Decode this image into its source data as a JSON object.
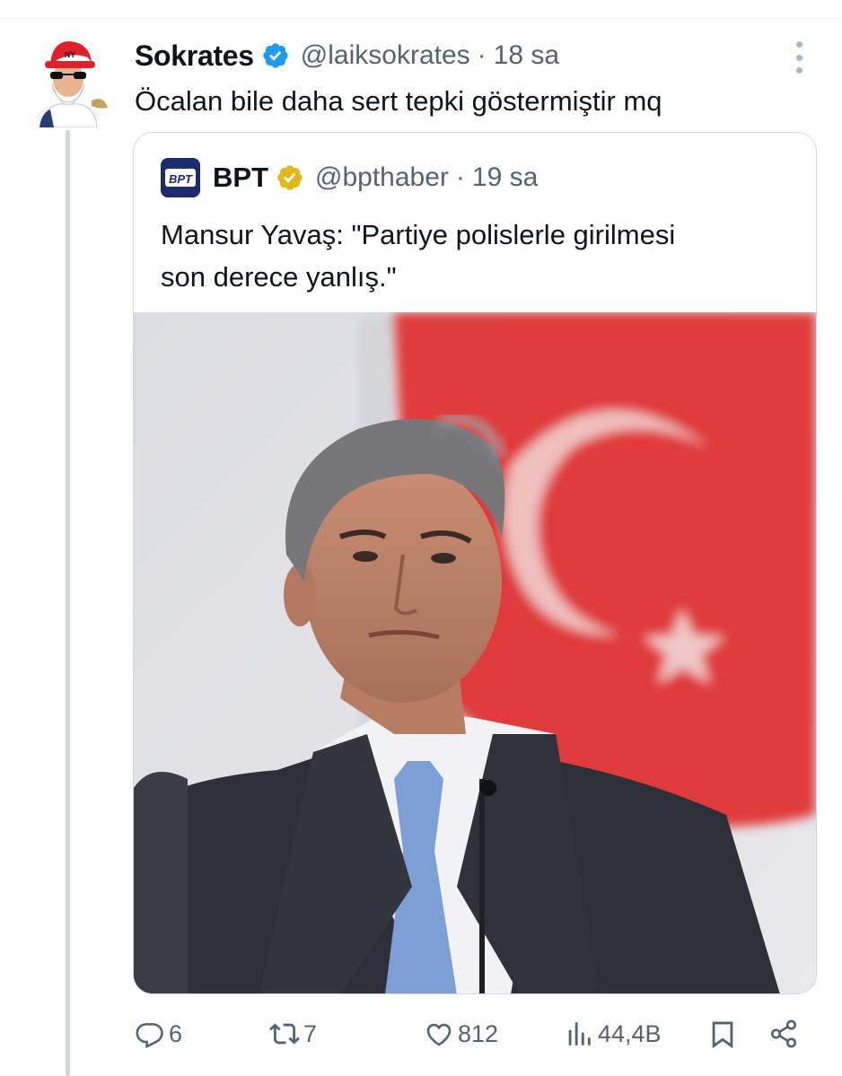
{
  "tweet": {
    "author": {
      "name": "Sokrates",
      "handle": "@laiksokrates",
      "verified": "blue",
      "avatar_icon": "avatar-cartoon-bearded-man"
    },
    "separator": "·",
    "time": "18 sa",
    "text": "Öcalan bile daha sert tepki göstermiştir mq"
  },
  "quote": {
    "author": {
      "name": "BPT",
      "handle": "@bpthaber",
      "verified": "gold",
      "avatar_icon": "bpt-logo-icon",
      "avatar_text": "BPT"
    },
    "separator": "·",
    "time": "19 sa",
    "text_lines": [
      "Mansur Yavaş: \"Partiye polislerle girilmesi",
      "son derece yanlış.\""
    ],
    "media_icon": "photo-man-in-suit-turkish-flag"
  },
  "actions": {
    "reply_count": "6",
    "retweet_count": "7",
    "like_count": "812",
    "view_count": "44,4B"
  },
  "colors": {
    "text": "#0f1419",
    "secondary": "#536471",
    "border": "#cfd9de",
    "verified_blue": "#1d9bf0",
    "verified_gold": "#e2b719",
    "flag_red": "#e30a17"
  }
}
